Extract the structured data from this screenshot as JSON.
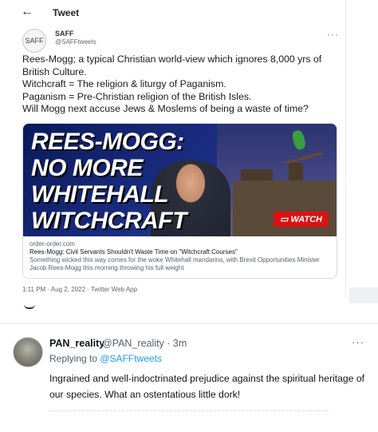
{
  "header": {
    "back_icon": "arrow-left-icon",
    "title": "Tweet"
  },
  "tweet": {
    "avatar_text": "SAFF",
    "display_name": "SAFF",
    "handle": "@SAFFtweets",
    "more": "···",
    "text": "Rees-Mogg; a typical Christian world-view which ignores 8,000 yrs of British Culture.\nWitchcraft = The religion & liturgy of Paganism.\nPaganism = Pre-Christian religion of the British Isles.\nWill Mogg next accuse Jews & Moslems of being a waste of time?",
    "card": {
      "headline": "REES-MOGG:\nNO MORE\nWHITEHALL\nWITCHCRAFT",
      "watch_label": "WATCH",
      "domain": "order-order.com",
      "title": "Rees-Mogg: Civil Servants Shouldn't Waste Time on \"Witchcraft Courses\"",
      "description": "Something wicked this way comes for the woke Whitehall mandarins, with Brexit Opportunities Minister Jacob Rees-Mogg this morning throwing his full weight"
    },
    "meta": "1:11 PM · Aug 2, 2022 · Twitter Web App"
  },
  "reply": {
    "display_name": "PAN_reality",
    "handle_time": "@PAN_reality · 3m",
    "more": "···",
    "replying_prefix": "Replying to ",
    "replying_to": "@SAFFtweets",
    "text": "Ingrained and well-indoctrinated prejudice against the spiritual heritage of our species. What an ostentatious little dork!"
  }
}
